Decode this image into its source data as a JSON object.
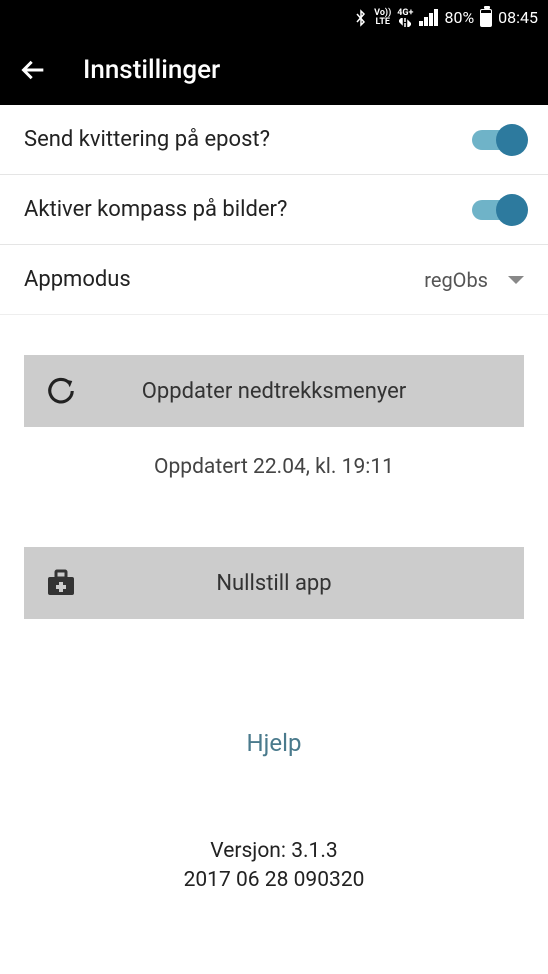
{
  "status_bar": {
    "volte_top": "Vo))",
    "volte_bottom": "LTE",
    "network_top": "4G+",
    "battery_percent": "80%",
    "time": "08:45"
  },
  "app_bar": {
    "title": "Innstillinger"
  },
  "settings": {
    "email_receipt": {
      "label": "Send kvittering på epost?",
      "enabled": true
    },
    "compass": {
      "label": "Aktiver kompass på bilder?",
      "enabled": true
    },
    "appmode": {
      "label": "Appmodus",
      "value": "regObs"
    }
  },
  "buttons": {
    "update_dropdowns": "Oppdater nedtrekksmenyer",
    "updated_text": "Oppdatert 22.04, kl. 19:11",
    "reset_app": "Nullstill app"
  },
  "help_link": "Hjelp",
  "version": {
    "label": "Versjon: 3.1.3",
    "build": "2017 06 28 090320"
  }
}
